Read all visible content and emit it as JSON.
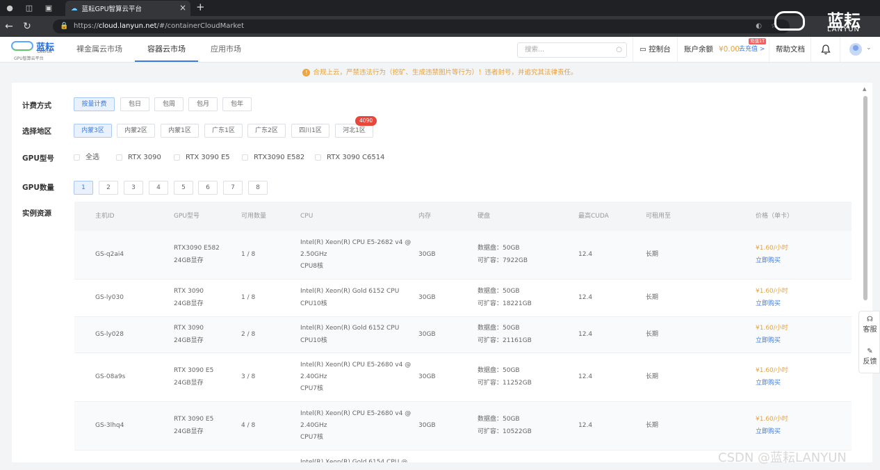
{
  "browser": {
    "tab_title": "蓝耘GPU智算云平台",
    "url_prefix": "https://",
    "url_host": "cloud.lanyun.net",
    "url_path": "/#/containerCloudMarket"
  },
  "logo": {
    "name": "蓝耘",
    "en": "LANYUN",
    "subtitle": "GPU智算云平台"
  },
  "nav": {
    "items": [
      "裸金属云市场",
      "容器云市场",
      "应用市场"
    ],
    "active": "容器云市场"
  },
  "header": {
    "search_placeholder": "搜索...",
    "console": "控制台",
    "balance_label": "账户余额",
    "balance": "¥0.00",
    "recharge": "去充值 >",
    "recharge_badge": "充值1T",
    "help": "帮助文档"
  },
  "notice": "合规上云，严禁违法行为（挖矿、生成违禁图片等行为）！违者封号，并追究其法律责任。",
  "filters": {
    "billing_label": "计费方式",
    "billing": [
      "按量计费",
      "包日",
      "包周",
      "包月",
      "包年"
    ],
    "billing_selected": "按量计费",
    "region_label": "选择地区",
    "regions": [
      "内蒙3区",
      "内蒙2区",
      "内蒙1区",
      "广东1区",
      "广东2区",
      "四川1区",
      "河北1区"
    ],
    "region_selected": "内蒙3区",
    "region_badge": "4090",
    "gpu_model_label": "GPU型号",
    "gpu_models": [
      "全选",
      "RTX 3090",
      "RTX 3090 E5",
      "RTX3090 E582",
      "RTX 3090 C6514"
    ],
    "gpu_count_label": "GPU数量",
    "gpu_counts": [
      "1",
      "2",
      "3",
      "4",
      "5",
      "6",
      "7",
      "8"
    ],
    "gpu_count_selected": "1",
    "resources_label": "实例资源"
  },
  "table": {
    "headers": [
      "主机ID",
      "GPU型号",
      "可用数量",
      "CPU",
      "内存",
      "硬盘",
      "最高CUDA",
      "可租用至",
      "价格（单卡）"
    ],
    "rows": [
      {
        "id": "GS-q2ai4",
        "gpu": "RTX3090 E582",
        "vram": "24GB显存",
        "avail": "1 / 8",
        "cpu1": "Intel(R) Xeon(R) CPU E5-2682 v4 @",
        "cpu2": "2.50GHz",
        "cpu3": "CPU8核",
        "mem": "30GB",
        "disk1": "数据盘：50GB",
        "disk2": "可扩容：7922GB",
        "cuda": "12.4",
        "until": "长期",
        "price": "¥1.60/小时",
        "buy": "立即购买"
      },
      {
        "id": "GS-ly030",
        "gpu": "RTX 3090",
        "vram": "24GB显存",
        "avail": "1 / 8",
        "cpu1": "Intel(R) Xeon(R) Gold 6152 CPU",
        "cpu2": "CPU10核",
        "cpu3": "",
        "mem": "30GB",
        "disk1": "数据盘：50GB",
        "disk2": "可扩容：18221GB",
        "cuda": "12.4",
        "until": "长期",
        "price": "¥1.60/小时",
        "buy": "立即购买"
      },
      {
        "id": "GS-ly028",
        "gpu": "RTX 3090",
        "vram": "24GB显存",
        "avail": "2 / 8",
        "cpu1": "Intel(R) Xeon(R) Gold 6152 CPU",
        "cpu2": "CPU10核",
        "cpu3": "",
        "mem": "30GB",
        "disk1": "数据盘：50GB",
        "disk2": "可扩容：21161GB",
        "cuda": "12.4",
        "until": "长期",
        "price": "¥1.60/小时",
        "buy": "立即购买"
      },
      {
        "id": "GS-08a9s",
        "gpu": "RTX 3090 E5",
        "vram": "24GB显存",
        "avail": "3 / 8",
        "cpu1": "Intel(R) Xeon(R) CPU E5-2680 v4 @",
        "cpu2": "2.40GHz",
        "cpu3": "CPU7核",
        "mem": "30GB",
        "disk1": "数据盘：50GB",
        "disk2": "可扩容：11252GB",
        "cuda": "12.4",
        "until": "长期",
        "price": "¥1.60/小时",
        "buy": "立即购买"
      },
      {
        "id": "GS-3lhq4",
        "gpu": "RTX 3090 E5",
        "vram": "24GB显存",
        "avail": "4 / 8",
        "cpu1": "Intel(R) Xeon(R) CPU E5-2680 v4 @",
        "cpu2": "2.40GHz",
        "cpu3": "CPU7核",
        "mem": "30GB",
        "disk1": "数据盘：50GB",
        "disk2": "可扩容：10522GB",
        "cuda": "12.4",
        "until": "长期",
        "price": "¥1.60/小时",
        "buy": "立即购买"
      }
    ],
    "partial_row_cpu": "Intel(R) Xeon(R) Gold 6154 CPU @"
  },
  "float": {
    "service": "客服",
    "feedback": "反馈"
  },
  "watermark": "CSDN @蓝耘LANYUN",
  "brand_watermark": {
    "cn": "蓝耘",
    "en": "LANYUN"
  },
  "colors": {
    "accent": "#3a7be0",
    "price": "#e6a23c",
    "badge": "#e8473b"
  }
}
